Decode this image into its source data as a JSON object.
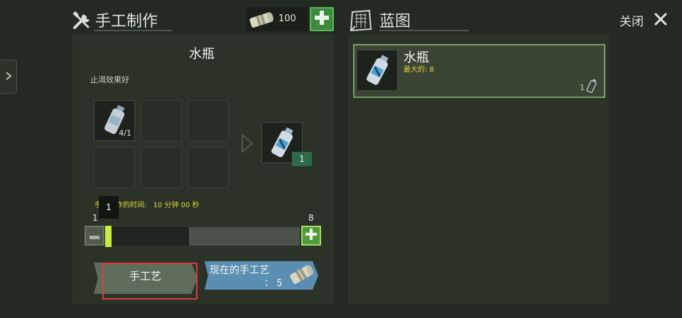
{
  "header": {
    "craft_title": "手工制作",
    "currency_amount": "100",
    "blueprint_title": "蓝图",
    "close_label": "关闭"
  },
  "item": {
    "name": "水瓶",
    "description": "止渴效果好",
    "ingredient_count": "4/1",
    "output_count": "1"
  },
  "craft_time": {
    "label": "手工制作的时间:",
    "value": "10 分钟 00 秒"
  },
  "slider": {
    "tooltip": "1",
    "min": "1",
    "max": "8",
    "fraction": 0.0
  },
  "buttons": {
    "craft": "手工艺",
    "current_line1": "现在的手工艺",
    "current_line2": "： 5"
  },
  "blueprint": {
    "name": "水瓶",
    "max_label": "最大的: 8",
    "count": "1"
  },
  "colors": {
    "accent_green": "#5fb55f",
    "max_yellow": "#e2d23a",
    "highlight_red": "#e2393f",
    "blue_button": "#5b8eb3"
  }
}
